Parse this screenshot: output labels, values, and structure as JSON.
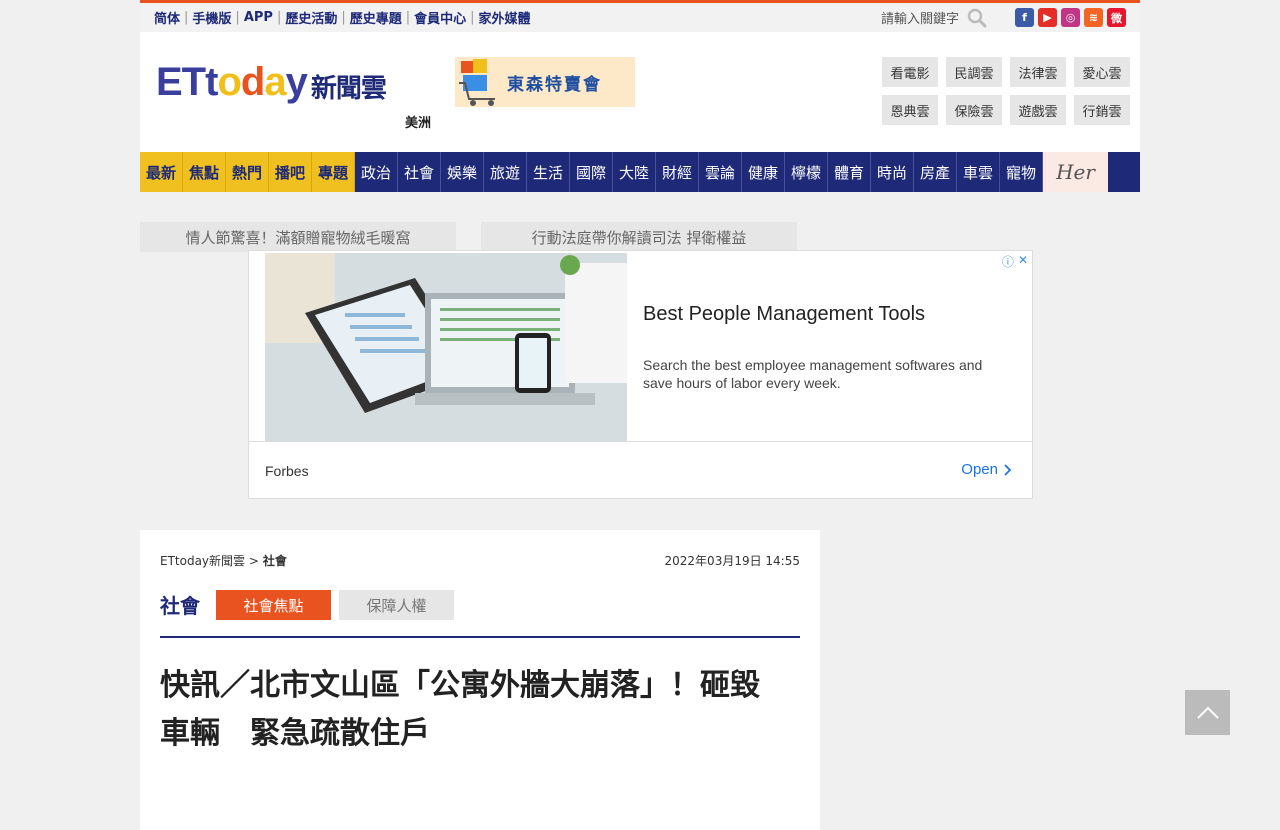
{
  "topbar": {
    "links": [
      "简体",
      "手機版",
      "APP",
      "歷史活動",
      "歷史專題",
      "會員中心",
      "家外媒體"
    ],
    "search_placeholder": "請輸入關鍵字",
    "social": [
      "f",
      "▶",
      "◎",
      "≋",
      "微"
    ]
  },
  "header": {
    "logo_cn": "新聞雲",
    "logo_region": "美洲",
    "banner_text": "東森特賣會",
    "clouds": [
      "看電影",
      "民調雲",
      "法律雲",
      "愛心雲",
      "恩典雲",
      "保險雲",
      "遊戲雲",
      "行銷雲"
    ]
  },
  "nav": {
    "highlight": [
      "最新",
      "焦點",
      "熱門",
      "播吧",
      "專題"
    ],
    "items": [
      "政治",
      "社會",
      "娛樂",
      "旅遊",
      "生活",
      "國際",
      "大陸",
      "財經",
      "雲論",
      "健康",
      "檸檬",
      "體育",
      "時尚",
      "房產",
      "車雲",
      "寵物"
    ],
    "her": "Her"
  },
  "promos": [
    "情人節驚喜！滿額贈寵物絨毛暖窩",
    "行動法庭帶你解讀司法 捍衛權益"
  ],
  "ad": {
    "title": "Best People Management Tools",
    "description": "Search the best employee management softwares and save hours of labor every week.",
    "brand": "Forbes",
    "cta": "Open"
  },
  "article": {
    "breadcrumb_root": "ETtoday新聞雲 >",
    "breadcrumb_section": "社會",
    "date": "2022年03月19日 14:55",
    "section": "社會",
    "tab_active": "社會焦點",
    "tab_inactive": "保障人權",
    "headline_line1": "快訊／北市文山區「公寓外牆大崩落」！砸毀",
    "headline_line2": "車輛　緊急疏散住戶"
  },
  "colors": {
    "brand_blue": "#1e2a78",
    "accent_orange": "#e8531f",
    "nav_yellow": "#f0c020"
  }
}
